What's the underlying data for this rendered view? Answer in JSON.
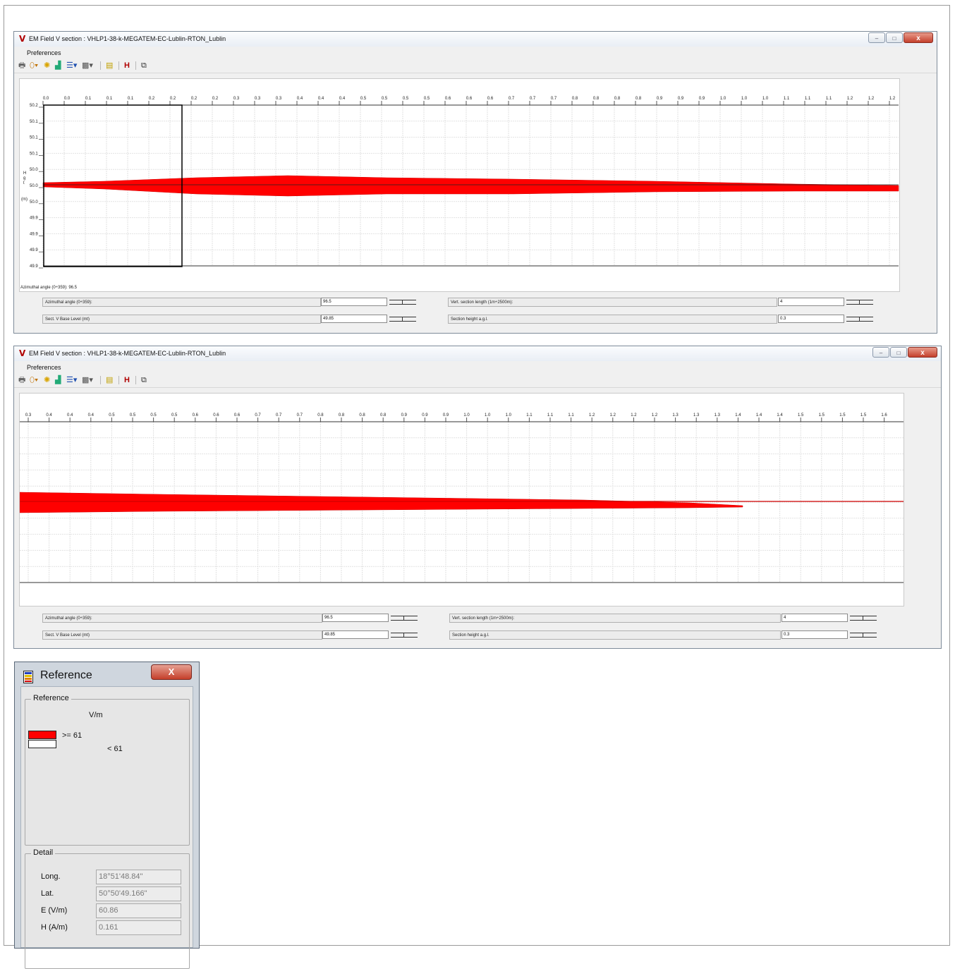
{
  "window1": {
    "title": "EM Field V section : VHLP1-38-k-MEGATEM-EC-Lublin-RTON_Lublin",
    "menu": "Preferences",
    "x_ticks": [
      "0.0",
      "0.0",
      "0.1",
      "0.1",
      "0.1",
      "0.2",
      "0.2",
      "0.2",
      "0.2",
      "0.3",
      "0.3",
      "0.3",
      "0.4",
      "0.4",
      "0.4",
      "0.5",
      "0.5",
      "0.5",
      "0.5",
      "0.6",
      "0.6",
      "0.6",
      "0.7",
      "0.7",
      "0.7",
      "0.8",
      "0.8",
      "0.8",
      "0.8",
      "0.9",
      "0.9",
      "0.9",
      "1.0",
      "1.0",
      "1.0",
      "1.1",
      "1.1",
      "1.1",
      "1.2",
      "1.2",
      "1.2",
      "1"
    ],
    "y_ticks": [
      "50.2",
      "50.1",
      "50.1",
      "50.1",
      "50.0",
      "50.0",
      "50.0",
      "49.9",
      "49.9",
      "49.9",
      "49.9"
    ],
    "y_axis_label": "H\ng\nt",
    "y_axis_unit": "(m)",
    "azimuth_readout": "Azimuthal angle (0÷359): 96.5",
    "controls": {
      "azimuthal_label": "Azimuthal angle (0÷359):",
      "azimuthal_value": "96.5",
      "base_level_label": "Sect. V Base Level (mt)",
      "base_level_value": "49.85",
      "vert_length_label": "Vert. section length (1m÷2500m):",
      "vert_length_value": "4",
      "section_height_label": "Section height a.g.l.",
      "section_height_value": "0.3"
    }
  },
  "window2": {
    "title": "EM Field V section : VHLP1-38-k-MEGATEM-EC-Lublin-RTON_Lublin",
    "menu": "Preferences",
    "x_ticks": [
      "0.3",
      "0.4",
      "0.4",
      "0.4",
      "0.5",
      "0.5",
      "0.5",
      "0.5",
      "0.6",
      "0.6",
      "0.6",
      "0.7",
      "0.7",
      "0.7",
      "0.8",
      "0.8",
      "0.8",
      "0.8",
      "0.9",
      "0.9",
      "0.9",
      "1.0",
      "1.0",
      "1.0",
      "1.1",
      "1.1",
      "1.1",
      "1.2",
      "1.2",
      "1.2",
      "1.2",
      "1.3",
      "1.3",
      "1.3",
      "1.4",
      "1.4",
      "1.4",
      "1.5",
      "1.5",
      "1.5",
      "1.5",
      "1.6"
    ],
    "controls": {
      "azimuthal_label": "Azimuthal angle (0÷359):",
      "azimuthal_value": "96.5",
      "base_level_label": "Sect. V Base Level (mt)",
      "base_level_value": "49.85",
      "vert_length_label": "Vert. section length (1m÷2500m):",
      "vert_length_value": "4",
      "section_height_label": "Section height a.g.l.",
      "section_height_value": "0.3"
    }
  },
  "reference": {
    "title": "Reference",
    "close_label": "X",
    "group_title": "Reference",
    "unit": "V/m",
    "legend": [
      {
        "label": ">= 61",
        "color": "#ff0000"
      },
      {
        "label": "< 61",
        "color": "#ffffff"
      }
    ],
    "detail_title": "Detail",
    "detail": [
      {
        "label": "Long.",
        "value": "18°51'48.84\""
      },
      {
        "label": "Lat.",
        "value": "50°50'49.166\""
      },
      {
        "label": "E (V/m)",
        "value": "60.86"
      },
      {
        "label": "H (A/m)",
        "value": "0.161"
      }
    ]
  },
  "colors": {
    "field": "#ff0000",
    "accent_icon": "#b00000"
  }
}
